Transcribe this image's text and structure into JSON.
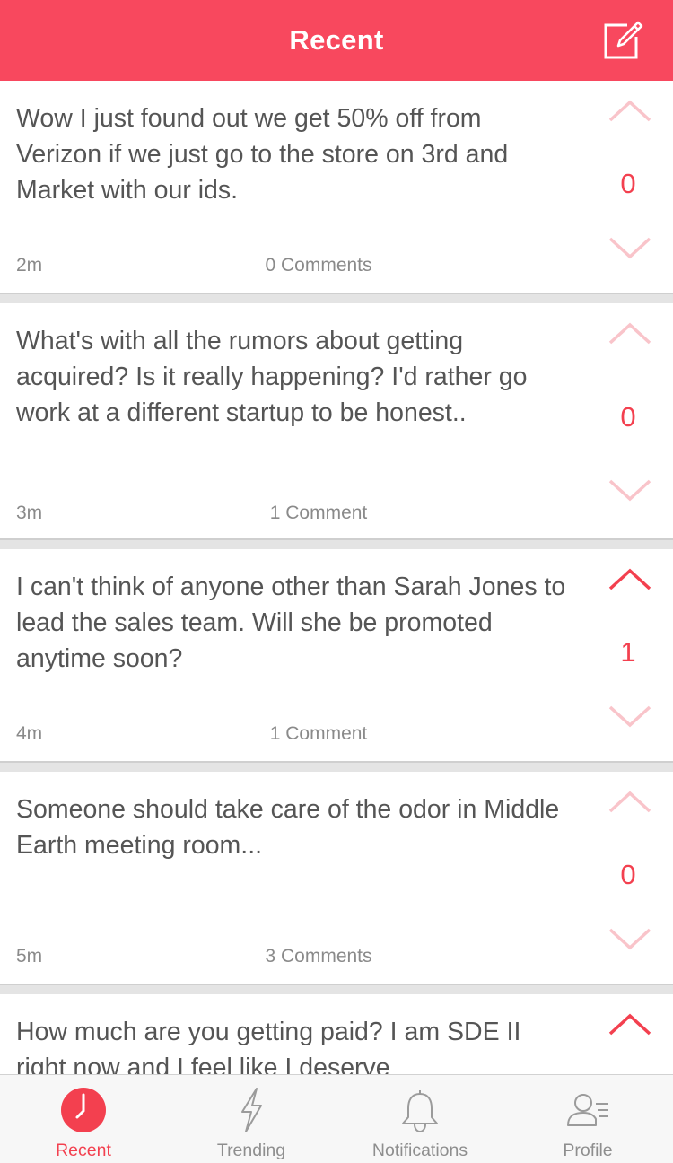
{
  "header": {
    "title": "Recent",
    "compose_icon": "compose-icon"
  },
  "colors": {
    "accent": "#f8485e",
    "vote_active": "#f3404f",
    "vote_inactive": "#f9c4ca"
  },
  "posts": [
    {
      "text": "Wow I just found out we get 50% off from Verizon if we just go to the store on 3rd and Market with our ids.",
      "time": "2m",
      "comments": "0 Comments",
      "votes": "0",
      "upvoted": false
    },
    {
      "text": "What's with all the rumors about getting acquired? Is it really happening? I'd rather go work at a different startup to be honest..",
      "time": "3m",
      "comments": "1 Comment",
      "votes": "0",
      "upvoted": false
    },
    {
      "text": "I can't think of anyone other than Sarah Jones to lead the sales team. Will she be promoted anytime soon?",
      "time": "4m",
      "comments": "1 Comment",
      "votes": "1",
      "upvoted": true
    },
    {
      "text": "Someone should take care of the odor in Middle Earth meeting room...",
      "time": "5m",
      "comments": "3 Comments",
      "votes": "0",
      "upvoted": false
    },
    {
      "text": "How much are you getting paid? I am SDE II right now and I feel like I deserve",
      "upvoted": true
    }
  ],
  "tabs": [
    {
      "label": "Recent",
      "icon": "clock-icon",
      "active": true
    },
    {
      "label": "Trending",
      "icon": "lightning-icon",
      "active": false
    },
    {
      "label": "Notifications",
      "icon": "bell-icon",
      "active": false
    },
    {
      "label": "Profile",
      "icon": "profile-icon",
      "active": false
    }
  ]
}
